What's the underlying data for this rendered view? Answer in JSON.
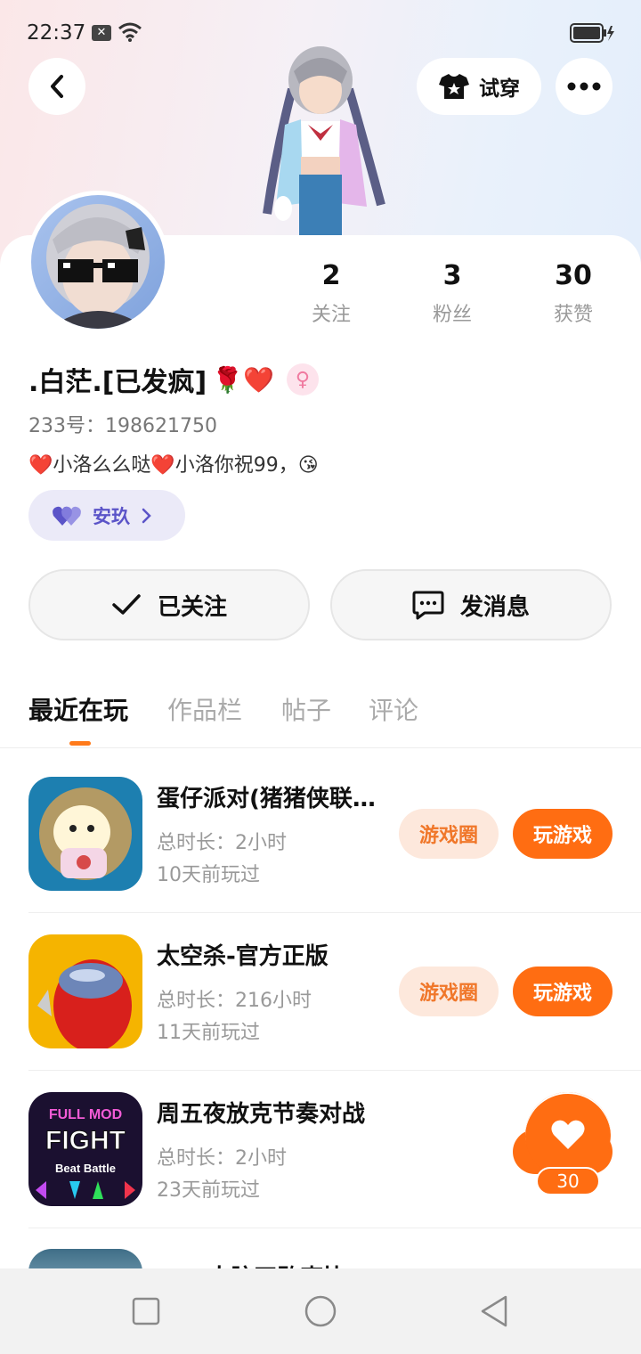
{
  "status_bar": {
    "time": "22:37",
    "icons": [
      "notification-x-icon",
      "wifi-icon",
      "battery-charging-icon"
    ]
  },
  "header": {
    "tryon_label": "试穿",
    "icons": [
      "back-icon",
      "tshirt-icon",
      "more-icon"
    ]
  },
  "stats": [
    {
      "value": "2",
      "label": "关注"
    },
    {
      "value": "3",
      "label": "粉丝"
    },
    {
      "value": "30",
      "label": "获赞"
    }
  ],
  "profile": {
    "name": ".白茫.[已发疯]",
    "name_emoji": "🌹❤️",
    "gender_symbol": "♀",
    "uid": "233号：198621750",
    "bio": "❤️小洛么么哒❤️小洛你祝99，😘",
    "tag_label": "安玖"
  },
  "actions": {
    "follow_label": "已关注",
    "message_label": "发消息"
  },
  "tabs": [
    {
      "label": "最近在玩",
      "active": true
    },
    {
      "label": "作品栏",
      "active": false
    },
    {
      "label": "帖子",
      "active": false
    },
    {
      "label": "评论",
      "active": false
    }
  ],
  "games": [
    {
      "title": "蛋仔派对(猪猪侠联…",
      "duration": "总时长：2小时",
      "last_played": "10天前玩过",
      "circle_label": "游戏圈",
      "play_label": "玩游戏"
    },
    {
      "title": "太空杀-官方正版",
      "duration": "总时长：216小时",
      "last_played": "11天前玩过",
      "circle_label": "游戏圈",
      "play_label": "玩游戏"
    },
    {
      "title": "周五夜放克节奏对战",
      "duration": "总时长：2小时",
      "last_played": "23天前玩过"
    }
  ],
  "game3_icon_text": {
    "line1": "FULL MOD",
    "line2": "FIGHT",
    "line3": "Beat Battle"
  },
  "partial_game_title": "FNF大脑四败克比",
  "like_fab": {
    "count": "30"
  },
  "colors": {
    "accent": "#ff6d12",
    "accent_light": "#fde8dc",
    "tag_purple": "#5b54c8"
  }
}
